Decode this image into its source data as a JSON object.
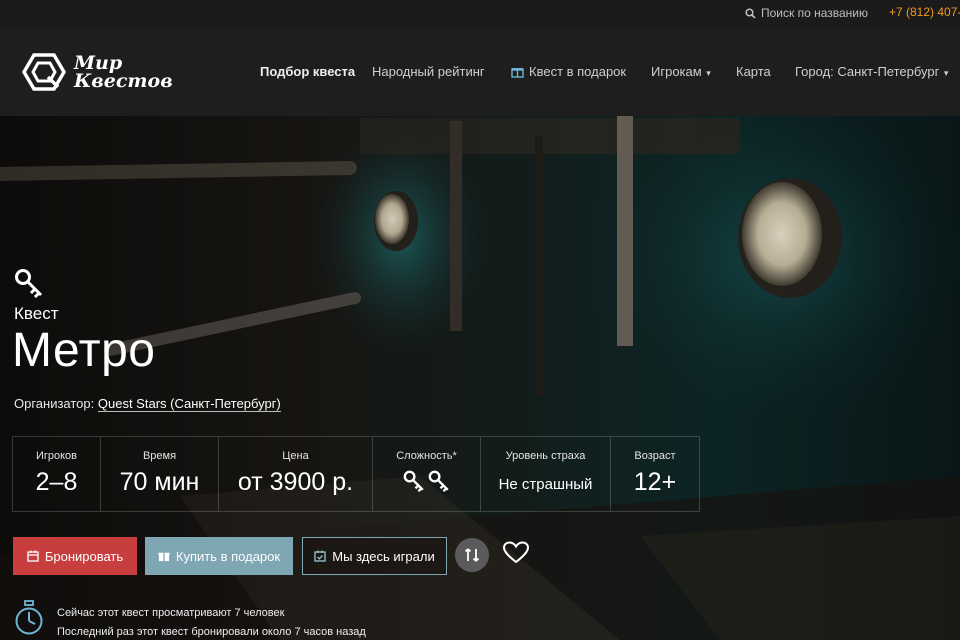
{
  "topbar": {
    "search_label": "Поиск по названию",
    "phone": "+7 (812) 407-"
  },
  "logo": {
    "line1": "Мир",
    "line2": "Квестов"
  },
  "nav": {
    "items": [
      {
        "label": "Подбор квеста"
      },
      {
        "label": "Народный рейтинг"
      },
      {
        "label": "Квест в подарок"
      },
      {
        "label": "Игрокам"
      },
      {
        "label": "Карта"
      },
      {
        "label": "Город: Санкт-Петербург"
      }
    ]
  },
  "quest": {
    "kind": "Квест",
    "title": "Метро",
    "organizer_label": "Организатор:",
    "organizer_name": "Quest Stars (Санкт-Петербург)"
  },
  "stats": [
    {
      "label": "Игроков",
      "value": "2–8"
    },
    {
      "label": "Время",
      "value": "70 мин"
    },
    {
      "label": "Цена",
      "value": "от 3900 р."
    },
    {
      "label": "Сложность*",
      "value": ""
    },
    {
      "label": "Уровень страха",
      "value": "Не страшный"
    },
    {
      "label": "Возраст",
      "value": "12+"
    }
  ],
  "difficulty_keys": 2,
  "actions": {
    "book": "Бронировать",
    "gift": "Купить в подарок",
    "played": "Мы здесь играли"
  },
  "info": {
    "viewing": "Сейчас этот квест просматривают 7 человек",
    "last_booked": "Последний раз этот квест бронировали около 7 часов назад"
  },
  "colors": {
    "accent_phone": "#f29a1f",
    "book_button": "#c83d3d",
    "gift_button": "#7ea6b3"
  }
}
